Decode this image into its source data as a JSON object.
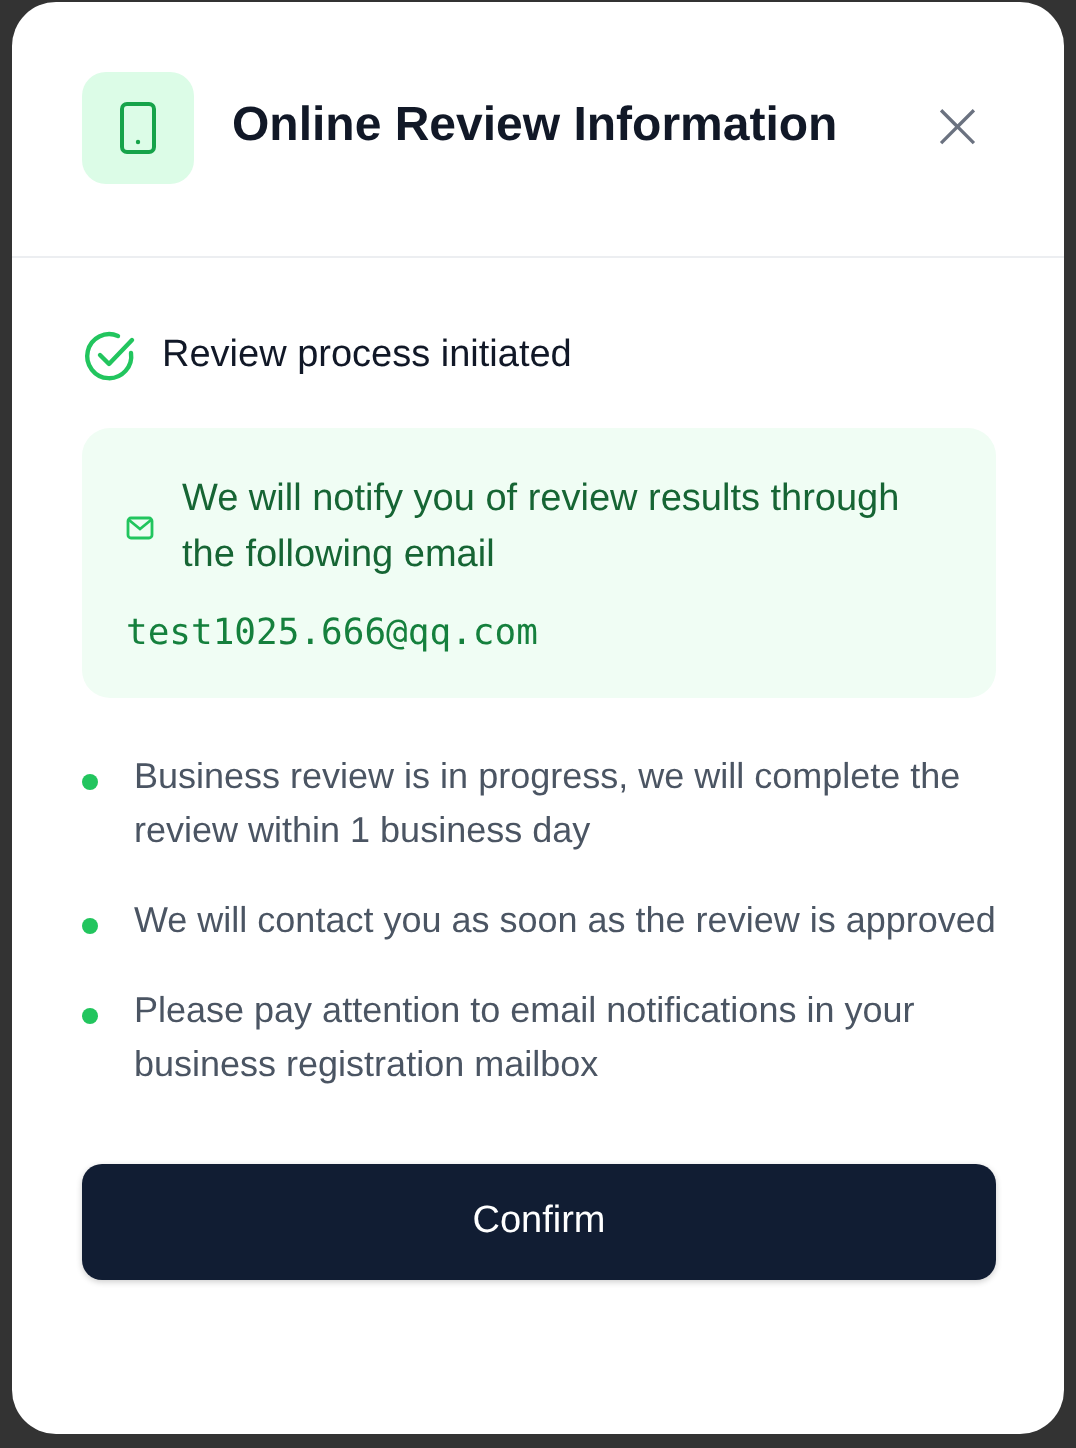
{
  "dialog": {
    "title": "Online Review Information",
    "close": "×"
  },
  "status": {
    "text": "Review process initiated"
  },
  "notice": {
    "text": "We will notify you of review results through the following email",
    "email": "test1025.666@qq.com"
  },
  "points": [
    {
      "text": "Business review is in progress, we will complete the review within 1 business day"
    },
    {
      "text": "We will contact you as soon as the review is approved"
    },
    {
      "text": "Please pay attention to email notifications in your business registration mailbox"
    }
  ],
  "buttons": [
    {
      "label": "Confirm"
    }
  ]
}
